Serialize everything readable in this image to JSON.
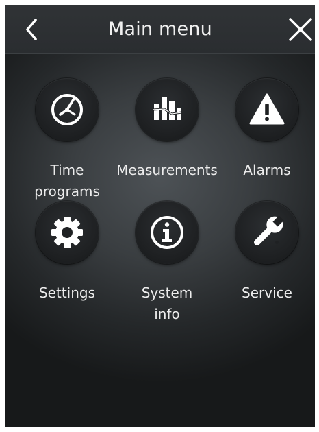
{
  "header": {
    "title": "Main menu",
    "back_icon": "chevron-left-icon",
    "close_icon": "close-icon"
  },
  "menu": {
    "items": [
      {
        "id": "time-programs",
        "icon": "clock-icon",
        "line1": "Time",
        "line2": "programs"
      },
      {
        "id": "measurements",
        "icon": "bar-chart-icon",
        "line1": "Measurements",
        "line2": ""
      },
      {
        "id": "alarms",
        "icon": "warning-icon",
        "line1": "Alarms",
        "line2": ""
      },
      {
        "id": "settings",
        "icon": "gear-icon",
        "line1": "Settings",
        "line2": ""
      },
      {
        "id": "system-info",
        "icon": "info-icon",
        "line1": "System",
        "line2": "info"
      },
      {
        "id": "service",
        "icon": "wrench-icon",
        "line1": "Service",
        "line2": ""
      }
    ]
  },
  "colors": {
    "text": "#ececec",
    "icon": "#ffffff",
    "background": "#3a3e41",
    "circle": "#1f2123"
  }
}
